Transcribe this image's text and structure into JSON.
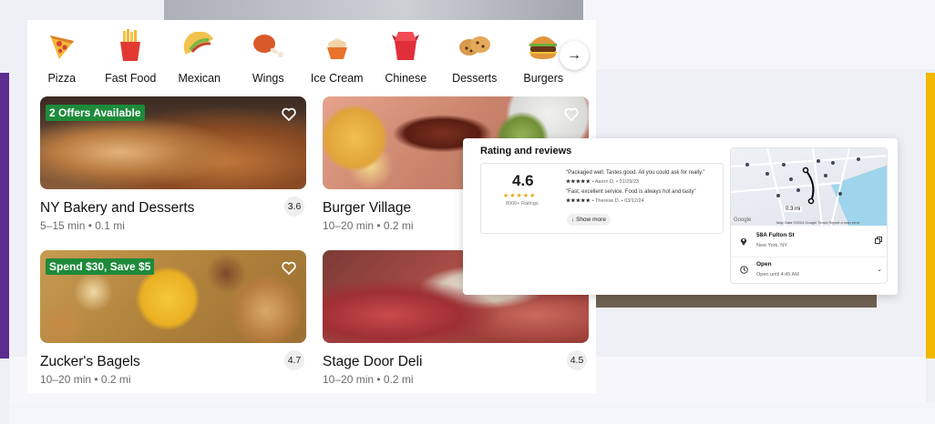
{
  "categories": [
    {
      "label": "Pizza",
      "icon": "pizza-icon"
    },
    {
      "label": "Fast Food",
      "icon": "fries-icon"
    },
    {
      "label": "Mexican",
      "icon": "taco-icon"
    },
    {
      "label": "Wings",
      "icon": "chicken-leg-icon"
    },
    {
      "label": "Ice Cream",
      "icon": "ice-cream-icon"
    },
    {
      "label": "Chinese",
      "icon": "takeout-box-icon"
    },
    {
      "label": "Desserts",
      "icon": "cookie-icon"
    },
    {
      "label": "Burgers",
      "icon": "burger-icon"
    }
  ],
  "next_icon": "arrow-right-icon",
  "stores": [
    {
      "name": "NY Bakery and Desserts",
      "meta": "5–15 min • 0.1 mi",
      "rating": "3.6",
      "badge": "2 Offers Available"
    },
    {
      "name": "Burger Village",
      "meta": "10–20 min • 0.2 mi",
      "rating": "",
      "badge": ""
    },
    {
      "name": "Zucker's Bagels",
      "meta": "10–20 min • 0.2 mi",
      "rating": "4.7",
      "badge": "Spend $30, Save $5"
    },
    {
      "name": "Stage Door Deli",
      "meta": "10–20 min • 0.2 mi",
      "rating": "4.5",
      "badge": ""
    }
  ],
  "reviews": {
    "title": "Rating and reviews",
    "score": "4.6",
    "stars": "★★★★★",
    "count": "8000+ Ratings",
    "items": [
      {
        "quote": "\"Packaged well. Tastes good. All you could ask for really.\"",
        "stars": "★★★★★",
        "author": "• Aaron D. • 01/29/23"
      },
      {
        "quote": "\"Fast, excellent service. Food is always hot and tasty\"",
        "stars": "★★★★★",
        "author": "• Therese D. • 03/12/24"
      }
    ],
    "show_more": "Show more"
  },
  "location": {
    "distance": "0.3 mi",
    "google": "Google",
    "map_attribution": "Map Data ©2024 Google   Terms   Report a map error",
    "address": "58A Fulton St",
    "city": "New York, NY",
    "status": "Open",
    "hours": "Open until 4:45 AM"
  },
  "colors": {
    "offer_badge": "#1e8a3a",
    "star": "#e6a817",
    "accent_left": "#5b2d8e",
    "accent_right": "#f0b800"
  }
}
